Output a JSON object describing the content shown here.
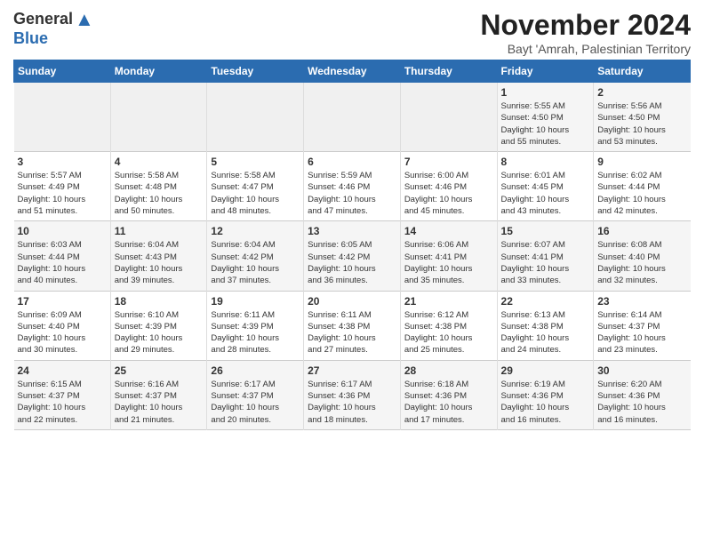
{
  "header": {
    "logo_general": "General",
    "logo_blue": "Blue",
    "month_title": "November 2024",
    "subtitle": "Bayt 'Amrah, Palestinian Territory"
  },
  "days_of_week": [
    "Sunday",
    "Monday",
    "Tuesday",
    "Wednesday",
    "Thursday",
    "Friday",
    "Saturday"
  ],
  "weeks": [
    [
      {
        "day": "",
        "text": ""
      },
      {
        "day": "",
        "text": ""
      },
      {
        "day": "",
        "text": ""
      },
      {
        "day": "",
        "text": ""
      },
      {
        "day": "",
        "text": ""
      },
      {
        "day": "1",
        "text": "Sunrise: 5:55 AM\nSunset: 4:50 PM\nDaylight: 10 hours\nand 55 minutes."
      },
      {
        "day": "2",
        "text": "Sunrise: 5:56 AM\nSunset: 4:50 PM\nDaylight: 10 hours\nand 53 minutes."
      }
    ],
    [
      {
        "day": "3",
        "text": "Sunrise: 5:57 AM\nSunset: 4:49 PM\nDaylight: 10 hours\nand 51 minutes."
      },
      {
        "day": "4",
        "text": "Sunrise: 5:58 AM\nSunset: 4:48 PM\nDaylight: 10 hours\nand 50 minutes."
      },
      {
        "day": "5",
        "text": "Sunrise: 5:58 AM\nSunset: 4:47 PM\nDaylight: 10 hours\nand 48 minutes."
      },
      {
        "day": "6",
        "text": "Sunrise: 5:59 AM\nSunset: 4:46 PM\nDaylight: 10 hours\nand 47 minutes."
      },
      {
        "day": "7",
        "text": "Sunrise: 6:00 AM\nSunset: 4:46 PM\nDaylight: 10 hours\nand 45 minutes."
      },
      {
        "day": "8",
        "text": "Sunrise: 6:01 AM\nSunset: 4:45 PM\nDaylight: 10 hours\nand 43 minutes."
      },
      {
        "day": "9",
        "text": "Sunrise: 6:02 AM\nSunset: 4:44 PM\nDaylight: 10 hours\nand 42 minutes."
      }
    ],
    [
      {
        "day": "10",
        "text": "Sunrise: 6:03 AM\nSunset: 4:44 PM\nDaylight: 10 hours\nand 40 minutes."
      },
      {
        "day": "11",
        "text": "Sunrise: 6:04 AM\nSunset: 4:43 PM\nDaylight: 10 hours\nand 39 minutes."
      },
      {
        "day": "12",
        "text": "Sunrise: 6:04 AM\nSunset: 4:42 PM\nDaylight: 10 hours\nand 37 minutes."
      },
      {
        "day": "13",
        "text": "Sunrise: 6:05 AM\nSunset: 4:42 PM\nDaylight: 10 hours\nand 36 minutes."
      },
      {
        "day": "14",
        "text": "Sunrise: 6:06 AM\nSunset: 4:41 PM\nDaylight: 10 hours\nand 35 minutes."
      },
      {
        "day": "15",
        "text": "Sunrise: 6:07 AM\nSunset: 4:41 PM\nDaylight: 10 hours\nand 33 minutes."
      },
      {
        "day": "16",
        "text": "Sunrise: 6:08 AM\nSunset: 4:40 PM\nDaylight: 10 hours\nand 32 minutes."
      }
    ],
    [
      {
        "day": "17",
        "text": "Sunrise: 6:09 AM\nSunset: 4:40 PM\nDaylight: 10 hours\nand 30 minutes."
      },
      {
        "day": "18",
        "text": "Sunrise: 6:10 AM\nSunset: 4:39 PM\nDaylight: 10 hours\nand 29 minutes."
      },
      {
        "day": "19",
        "text": "Sunrise: 6:11 AM\nSunset: 4:39 PM\nDaylight: 10 hours\nand 28 minutes."
      },
      {
        "day": "20",
        "text": "Sunrise: 6:11 AM\nSunset: 4:38 PM\nDaylight: 10 hours\nand 27 minutes."
      },
      {
        "day": "21",
        "text": "Sunrise: 6:12 AM\nSunset: 4:38 PM\nDaylight: 10 hours\nand 25 minutes."
      },
      {
        "day": "22",
        "text": "Sunrise: 6:13 AM\nSunset: 4:38 PM\nDaylight: 10 hours\nand 24 minutes."
      },
      {
        "day": "23",
        "text": "Sunrise: 6:14 AM\nSunset: 4:37 PM\nDaylight: 10 hours\nand 23 minutes."
      }
    ],
    [
      {
        "day": "24",
        "text": "Sunrise: 6:15 AM\nSunset: 4:37 PM\nDaylight: 10 hours\nand 22 minutes."
      },
      {
        "day": "25",
        "text": "Sunrise: 6:16 AM\nSunset: 4:37 PM\nDaylight: 10 hours\nand 21 minutes."
      },
      {
        "day": "26",
        "text": "Sunrise: 6:17 AM\nSunset: 4:37 PM\nDaylight: 10 hours\nand 20 minutes."
      },
      {
        "day": "27",
        "text": "Sunrise: 6:17 AM\nSunset: 4:36 PM\nDaylight: 10 hours\nand 18 minutes."
      },
      {
        "day": "28",
        "text": "Sunrise: 6:18 AM\nSunset: 4:36 PM\nDaylight: 10 hours\nand 17 minutes."
      },
      {
        "day": "29",
        "text": "Sunrise: 6:19 AM\nSunset: 4:36 PM\nDaylight: 10 hours\nand 16 minutes."
      },
      {
        "day": "30",
        "text": "Sunrise: 6:20 AM\nSunset: 4:36 PM\nDaylight: 10 hours\nand 16 minutes."
      }
    ]
  ]
}
